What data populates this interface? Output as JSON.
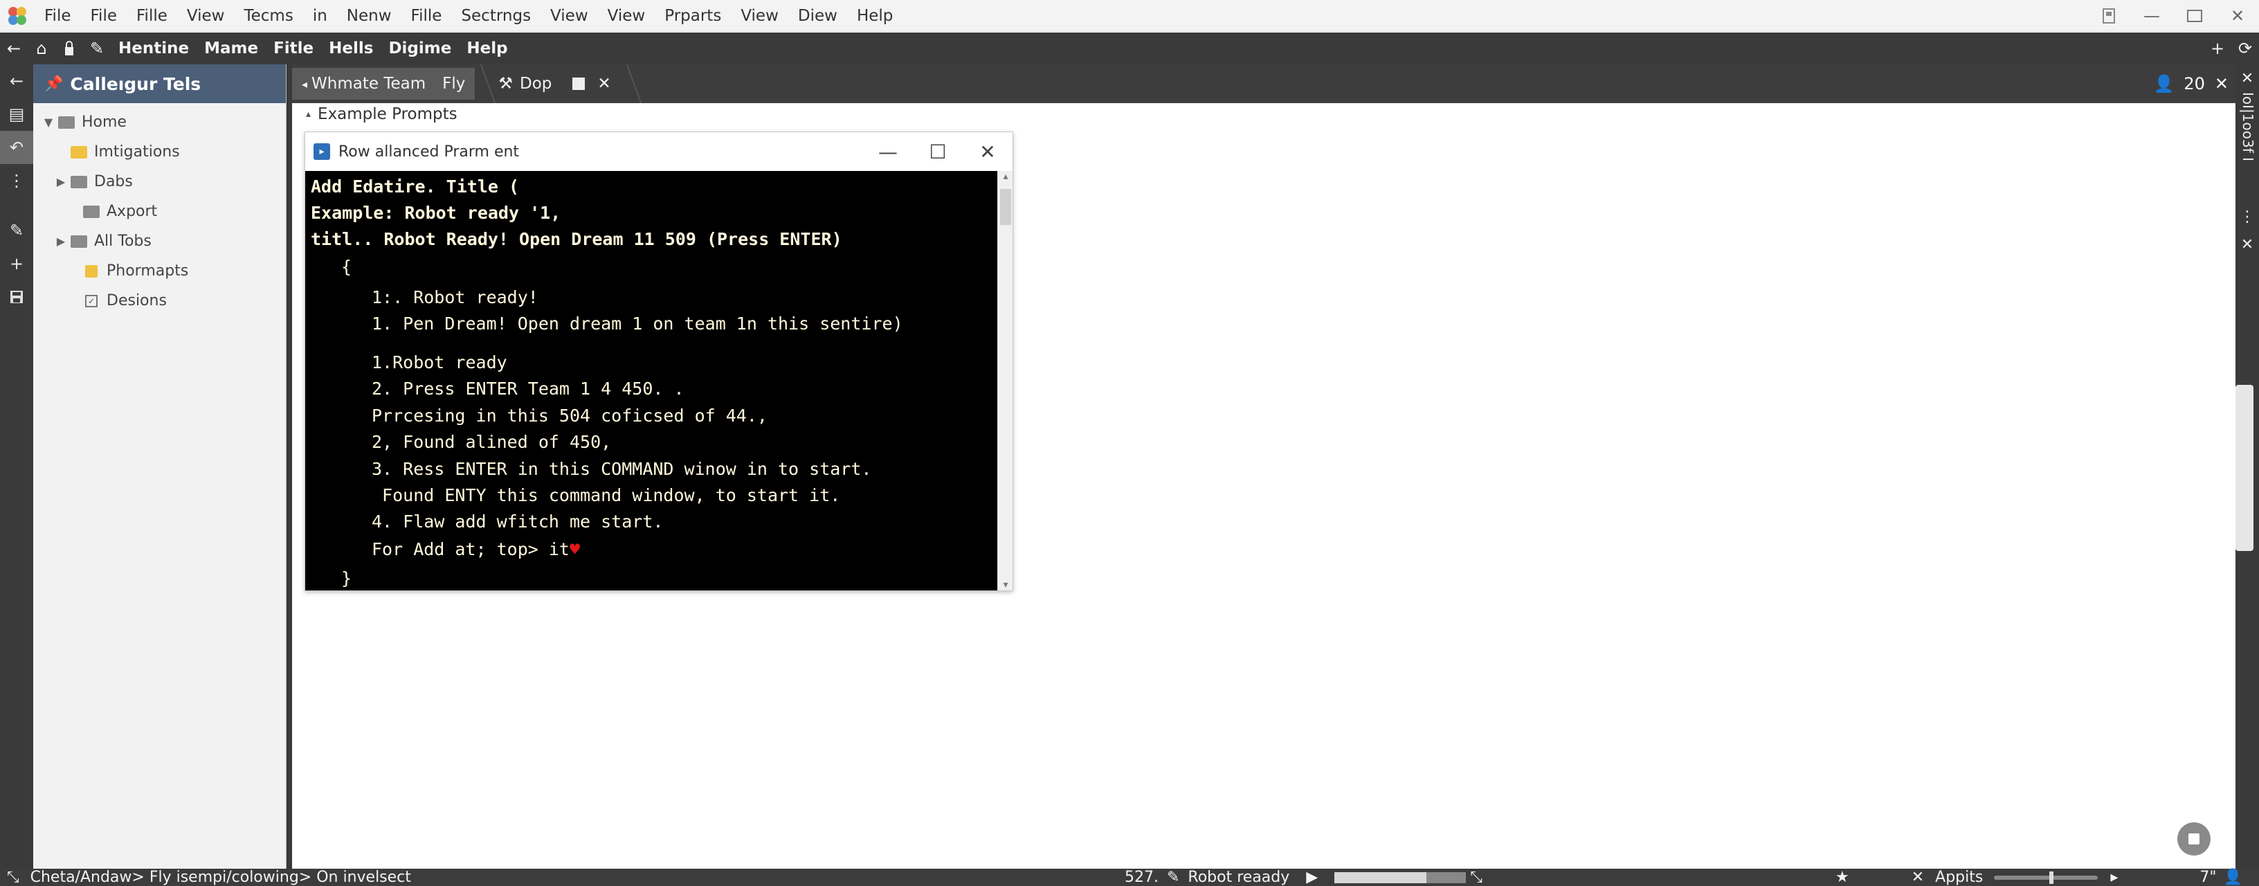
{
  "menubar": {
    "items": [
      "File",
      "File",
      "Fille",
      "View",
      "Tecms",
      "in",
      "Nenw",
      "Fille",
      "Sectrngs",
      "View",
      "View",
      "Prparts",
      "View",
      "Diew",
      "Help"
    ]
  },
  "toolbar": {
    "items": [
      "Hentine",
      "Mame",
      "Fitle",
      "Hells",
      "Digime",
      "Help"
    ]
  },
  "sidebar": {
    "title": "Calleıgur Tels",
    "items": [
      {
        "label": "Home",
        "indent": 0,
        "twisty": "expanded",
        "icon": "home-folder-icon"
      },
      {
        "label": "Imtigations",
        "indent": 1,
        "twisty": "none",
        "icon": "folder-yellow-icon"
      },
      {
        "label": "Dabs",
        "indent": 1,
        "twisty": "collapsed",
        "icon": "folder-icon"
      },
      {
        "label": "Axport",
        "indent": 2,
        "twisty": "none",
        "icon": "folder-icon"
      },
      {
        "label": "All Tobs",
        "indent": 1,
        "twisty": "collapsed",
        "icon": "folder-icon"
      },
      {
        "label": "Phormapts",
        "indent": 2,
        "twisty": "none",
        "icon": "lock-icon"
      },
      {
        "label": "Desions",
        "indent": 2,
        "twisty": "none",
        "icon": "checkbox-icon"
      }
    ]
  },
  "tabs": {
    "items": [
      "Whmate Team",
      "Fly",
      "Dop"
    ],
    "counter": "20"
  },
  "main": {
    "section_title": "Example Prompts"
  },
  "console": {
    "title": "Row allanced Prarm ent",
    "lines": [
      {
        "text": "Add Edatire. Title (",
        "indent": 0,
        "bold": true
      },
      {
        "text": "Example: Robot ready '1,",
        "indent": 0,
        "bold": true
      },
      {
        "text": "titl.. Robot Ready! Open Dream 11 509 (Press ENTER)",
        "indent": 0,
        "bold": true
      },
      {
        "text": "{",
        "indent": 1,
        "bold": false
      },
      {
        "text": "1:. Robot ready!",
        "indent": 2,
        "bold": false
      },
      {
        "text": "1. Pen Dream! Open dream 1 on team 1n this sentire)",
        "indent": 2,
        "bold": false
      },
      {
        "text": "1.Robot ready",
        "indent": 2,
        "bold": false
      },
      {
        "text": "2. Press ENTER Team 1 4 450. .",
        "indent": 2,
        "bold": false
      },
      {
        "text": "Prrcesing in this 504 coficsed of 44.,",
        "indent": 2,
        "bold": false
      },
      {
        "text": "2, Found alined of 450,",
        "indent": 2,
        "bold": false
      },
      {
        "text": "3. Ress ENTER in this COMMAND winow in to start.",
        "indent": 2,
        "bold": false
      },
      {
        "text": " Found ENTY this command window, to start it.",
        "indent": 2,
        "bold": false
      },
      {
        "text": "4. Flaw add wfitch me start.",
        "indent": 2,
        "bold": false
      },
      {
        "text": "For Add at; top> it",
        "indent": 2,
        "bold": false
      },
      {
        "text": "}",
        "indent": 1,
        "bold": false
      }
    ]
  },
  "rightstrip": {
    "vertical_label": "IoI|1oo3f I"
  },
  "statusbar": {
    "path": "Cheta/Andaw> Fly isempi/colowing> On invelsect",
    "number": "527.",
    "status": "Robot reaady",
    "progress": 0.7,
    "apps_label": "Appits",
    "zoom": "7\""
  },
  "colors": {
    "dark_chrome": "#3a3a3a",
    "sidebar_header": "#4c5f78",
    "console_bg": "#000000",
    "console_text": "#fff8dc",
    "heart": "#e01818"
  }
}
